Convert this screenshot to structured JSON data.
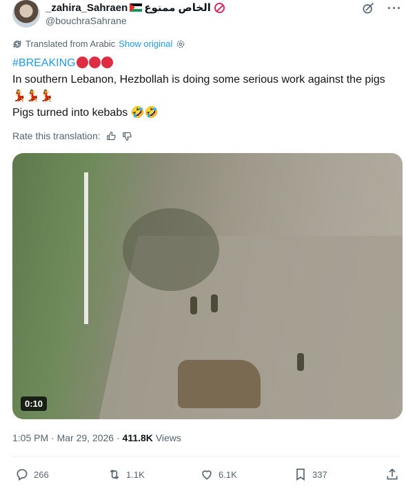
{
  "author": {
    "display_name": "_zahira_Sahraen",
    "name_suffix": "الخاص ممنوع",
    "handle": "@bouchraSahrane"
  },
  "header_icons": [
    "grok-icon",
    "more-icon"
  ],
  "translation": {
    "label": "Translated from Arabic",
    "show_original": "Show original"
  },
  "tweet": {
    "hashtag": "#BREAKING",
    "line1": "In southern Lebanon, Hezbollah is doing some serious work against the pigs",
    "line1_emoji": "💃💃💃",
    "line2": "Pigs turned into kebabs",
    "line2_emoji": "🤣🤣"
  },
  "rate_label": "Rate this translation:",
  "media": {
    "duration": "0:10"
  },
  "meta": {
    "time": "1:05 PM",
    "separator": "·",
    "date": "Mar 29, 2026",
    "views_count": "411.8K",
    "views_label": "Views"
  },
  "actions": {
    "replies": "266",
    "reposts": "1.1K",
    "likes": "6.1K",
    "bookmarks": "337"
  },
  "colors": {
    "accent": "#1d9bf0",
    "secondary_text": "#536471",
    "red_circle": "#dd2e44"
  }
}
